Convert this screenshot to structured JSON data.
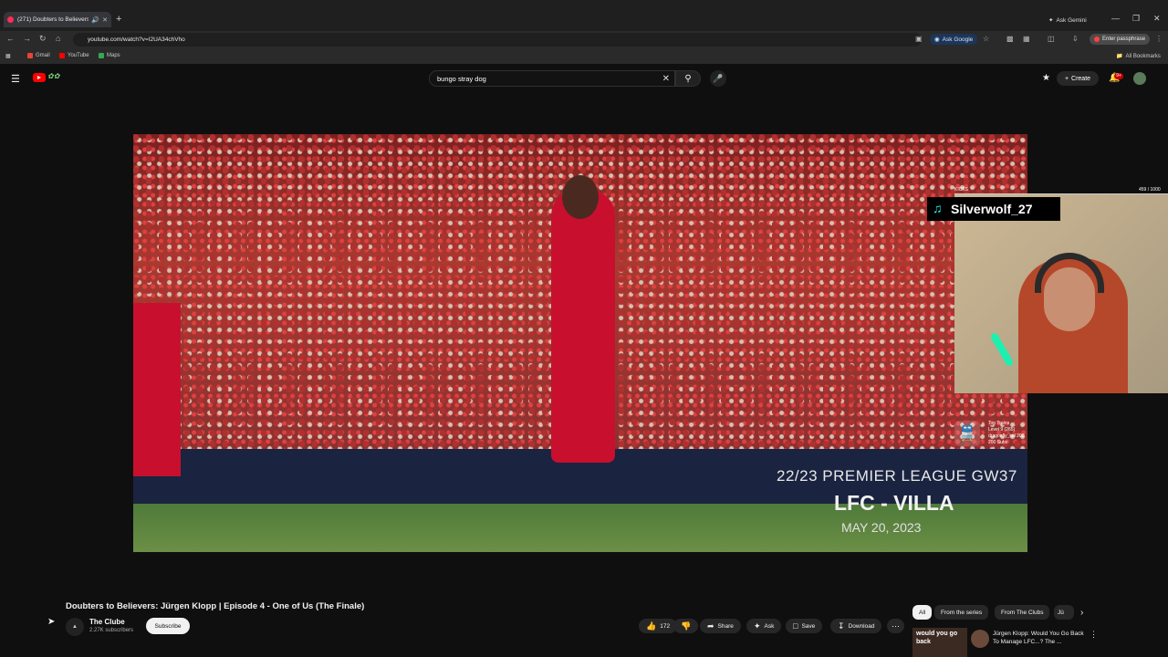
{
  "browser": {
    "tab_title": "(271) Doubters to Believers:",
    "new_tab": "+",
    "ask_gemini": "Ask Gemini",
    "url": "youtube.com/watch?v=I2UA34chVho",
    "ask_google": "Ask Google",
    "enter_passphrase": "Enter passphrase",
    "bookmarks": [
      "Gmail",
      "YouTube",
      "Maps"
    ],
    "all_bookmarks": "All Bookmarks"
  },
  "youtube": {
    "search_value": "bungo stray dog",
    "create_label": "Create",
    "notifications_badge": "9+"
  },
  "video": {
    "overlay_line1": "22/23 PREMIER LEAGUE GW37",
    "overlay_line2": "LFC - VILLA",
    "overlay_line3": "MAY 20, 2023",
    "title": "Doubters to Believers: Jürgen Klopp | Episode 4 - One of Us (The Finale)"
  },
  "stream_overlay": {
    "kicks_label": "KICKS",
    "kicks_value": "459 / 1000",
    "kicks_fraction": 0.459,
    "tiktok_user": "Silverwolf_27",
    "trains": [
      "Top Trains",
      "Level 9 (265)",
      "dragonfly_kid 200",
      "200 Subs"
    ]
  },
  "channel": {
    "name": "The Clube",
    "subscribers": "2.27K subscribers",
    "subscribe_label": "Subscribe"
  },
  "actions": {
    "likes": "172",
    "share": "Share",
    "ask": "Ask",
    "save": "Save",
    "download": "Download"
  },
  "chips": [
    "All",
    "From the series",
    "From The Clubs",
    "Jü"
  ],
  "recommendation": {
    "thumb_text": "would you go back",
    "title": "Jürgen Klopp: Would You Go Back To Manage LFC...? The ..."
  }
}
